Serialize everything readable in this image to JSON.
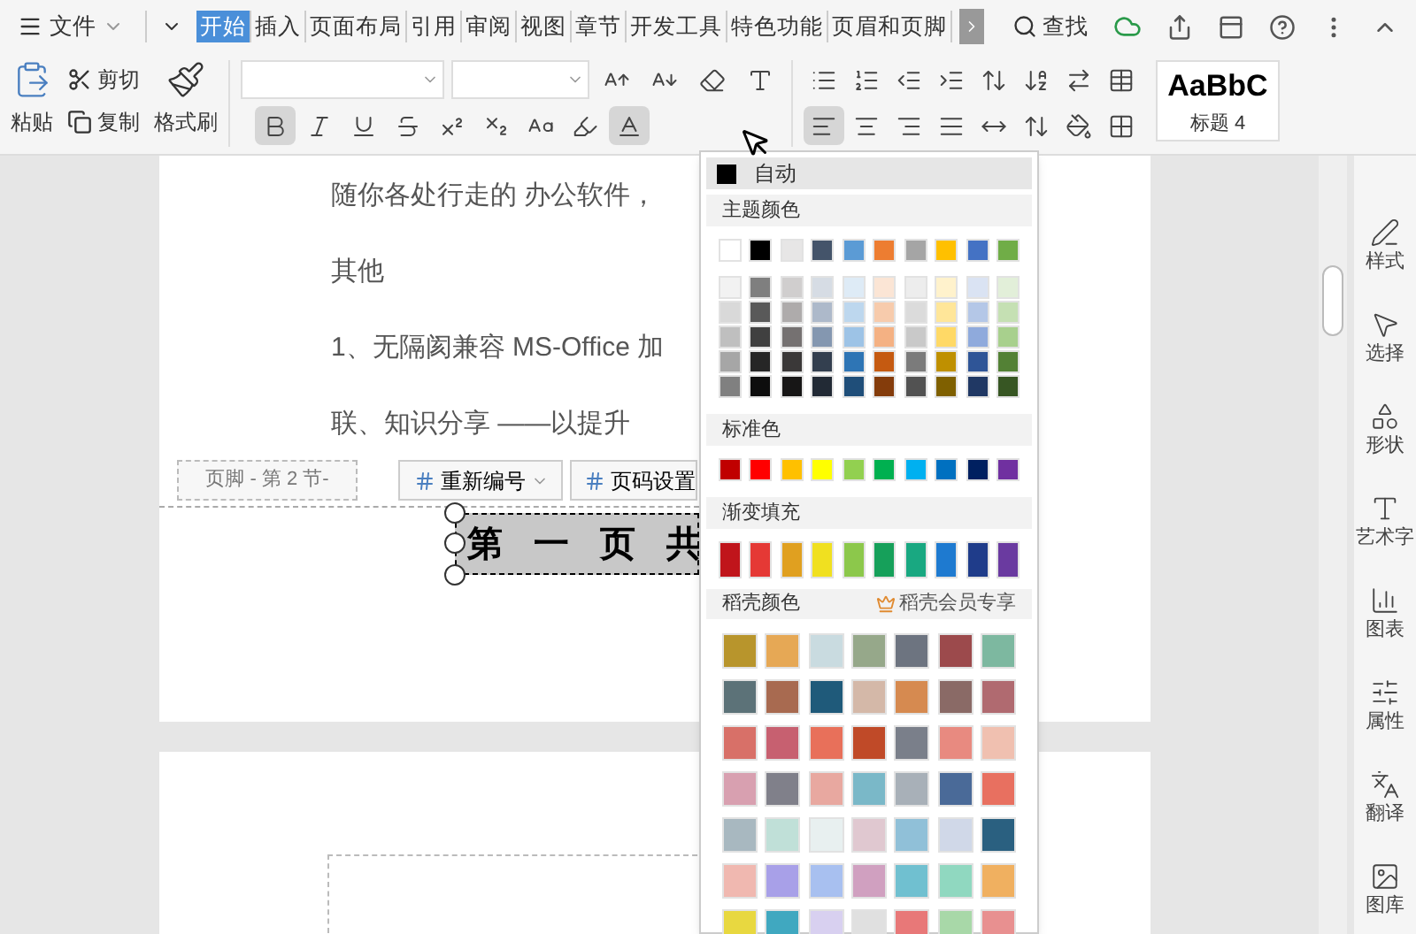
{
  "menu": {
    "label": "文件"
  },
  "tabs": [
    {
      "label": "开始",
      "selected": true
    },
    {
      "label": "插入",
      "selected": false
    },
    {
      "label": "页面布局",
      "selected": false
    },
    {
      "label": "引用",
      "selected": false
    },
    {
      "label": "审阅",
      "selected": false
    },
    {
      "label": "视图",
      "selected": false
    },
    {
      "label": "章节",
      "selected": false
    },
    {
      "label": "开发工具",
      "selected": false
    },
    {
      "label": "特色功能",
      "selected": false
    },
    {
      "label": "页眉和页脚",
      "selected": false
    }
  ],
  "search": {
    "label": "查找"
  },
  "ribbon": {
    "paste": "粘贴",
    "cut": "剪切",
    "copy": "复制",
    "format_painter": "格式刷",
    "font_tools": [
      {
        "kind": "grow",
        "pressed": false
      },
      {
        "kind": "shrink",
        "pressed": false
      },
      {
        "kind": "clear",
        "pressed": false
      },
      {
        "kind": "phonetic",
        "pressed": false
      }
    ],
    "format_buttons": [
      {
        "kind": "bold",
        "pressed": true
      },
      {
        "kind": "italic",
        "pressed": false
      },
      {
        "kind": "underline",
        "pressed": false
      },
      {
        "kind": "strike",
        "pressed": false
      },
      {
        "kind": "superscript",
        "pressed": false
      },
      {
        "kind": "subscript",
        "pressed": false
      },
      {
        "kind": "effect",
        "pressed": false
      },
      {
        "kind": "highlight",
        "pressed": false
      },
      {
        "kind": "color",
        "pressed": true
      }
    ],
    "paragraph_tools": [
      {
        "kind": "bullets",
        "pressed": false
      },
      {
        "kind": "numbering",
        "pressed": false
      },
      {
        "kind": "outdent",
        "pressed": false
      },
      {
        "kind": "indent",
        "pressed": false
      },
      {
        "kind": "spacing",
        "pressed": false
      },
      {
        "kind": "sort",
        "pressed": false
      },
      {
        "kind": "tabs",
        "pressed": false
      },
      {
        "kind": "table",
        "pressed": false
      }
    ],
    "align_tools": [
      {
        "kind": "left",
        "pressed": true
      },
      {
        "kind": "center",
        "pressed": false
      },
      {
        "kind": "right",
        "pressed": false
      },
      {
        "kind": "justify",
        "pressed": false
      },
      {
        "kind": "distribute",
        "pressed": false
      },
      {
        "kind": "linespacing",
        "pressed": false
      },
      {
        "kind": "shading",
        "pressed": false
      },
      {
        "kind": "borders",
        "pressed": false
      }
    ],
    "style": {
      "sample": "AaBbC",
      "name": "标题 4"
    }
  },
  "document": {
    "paragraphs": [
      "随你各处行走的 办公软件，",
      "其他",
      "1、无隔阂兼容 MS-Office 加",
      "联、知识分享 ——以提升"
    ],
    "footer": {
      "label": "页脚 - 第 2 节-",
      "buttons": [
        "重新编号",
        "页码设置"
      ],
      "text": "第 一 页 共"
    }
  },
  "color_menu": {
    "auto": {
      "label": "自动",
      "selected": true
    },
    "theme": {
      "title": "主题颜色",
      "colors": [
        {
          "color": "#ffffff"
        },
        {
          "color": "#000000"
        },
        {
          "color": "#e7e6e6"
        },
        {
          "color": "#44546a"
        },
        {
          "color": "#5b9bd5"
        },
        {
          "color": "#ed7d31"
        },
        {
          "color": "#a5a5a5"
        },
        {
          "color": "#ffc000"
        },
        {
          "color": "#4472c4"
        },
        {
          "color": "#70ad47"
        }
      ],
      "shades": [
        [
          {
            "color": "#f2f2f2"
          },
          {
            "color": "#7f7f7f"
          },
          {
            "color": "#d0cece"
          },
          {
            "color": "#d6dce4"
          },
          {
            "color": "#deebf6"
          },
          {
            "color": "#fbe5d5"
          },
          {
            "color": "#ededed"
          },
          {
            "color": "#fff2cc"
          },
          {
            "color": "#dae3f3"
          },
          {
            "color": "#e2efd9"
          }
        ],
        [
          {
            "color": "#d9d9d9"
          },
          {
            "color": "#595959"
          },
          {
            "color": "#aeabab"
          },
          {
            "color": "#adb9ca"
          },
          {
            "color": "#bdd7ee"
          },
          {
            "color": "#f7cbac"
          },
          {
            "color": "#dbdbdb"
          },
          {
            "color": "#ffe699"
          },
          {
            "color": "#b4c7e7"
          },
          {
            "color": "#c5e0b3"
          }
        ],
        [
          {
            "color": "#bfbfbf"
          },
          {
            "color": "#404040"
          },
          {
            "color": "#757171"
          },
          {
            "color": "#8497b0"
          },
          {
            "color": "#9dc3e6"
          },
          {
            "color": "#f4b183"
          },
          {
            "color": "#c9c9c9"
          },
          {
            "color": "#ffd966"
          },
          {
            "color": "#8faadc"
          },
          {
            "color": "#a8d08d"
          }
        ],
        [
          {
            "color": "#a6a6a6"
          },
          {
            "color": "#262626"
          },
          {
            "color": "#3a3838"
          },
          {
            "color": "#333f4f"
          },
          {
            "color": "#2e75b5"
          },
          {
            "color": "#c55a11"
          },
          {
            "color": "#7b7b7b"
          },
          {
            "color": "#bf9000"
          },
          {
            "color": "#2f5597"
          },
          {
            "color": "#538135"
          }
        ],
        [
          {
            "color": "#808080"
          },
          {
            "color": "#0d0d0d"
          },
          {
            "color": "#171616"
          },
          {
            "color": "#222a35"
          },
          {
            "color": "#1f4e79"
          },
          {
            "color": "#843c0b"
          },
          {
            "color": "#525252"
          },
          {
            "color": "#7f6000"
          },
          {
            "color": "#203864"
          },
          {
            "color": "#375623"
          }
        ]
      ]
    },
    "standard": {
      "title": "标准色",
      "colors": [
        {
          "color": "#c00000"
        },
        {
          "color": "#ff0000"
        },
        {
          "color": "#ffc000"
        },
        {
          "color": "#ffff00"
        },
        {
          "color": "#92d050"
        },
        {
          "color": "#00b050"
        },
        {
          "color": "#00b0f0"
        },
        {
          "color": "#0070c0"
        },
        {
          "color": "#002060"
        },
        {
          "color": "#7030a0"
        }
      ]
    },
    "gradient": {
      "title": "渐变填充",
      "colors": [
        {
          "color": "#c0151b"
        },
        {
          "color": "#e53935"
        },
        {
          "color": "#e0a020"
        },
        {
          "color": "#f0e020"
        },
        {
          "color": "#8cc84b"
        },
        {
          "color": "#16a05a"
        },
        {
          "color": "#19a881"
        },
        {
          "color": "#1e7ad0"
        },
        {
          "color": "#1f3c8a"
        },
        {
          "color": "#6a3aa0"
        }
      ]
    },
    "docer": {
      "title": "稻壳颜色",
      "badge": "稻壳会员专享",
      "rows": [
        [
          {
            "color": "#b8952c"
          },
          {
            "color": "#e6a855"
          },
          {
            "color": "#c9dbe0"
          },
          {
            "color": "#96a88a"
          },
          {
            "color": "#6d7480"
          },
          {
            "color": "#9c4a4c"
          },
          {
            "color": "#7db8a0"
          }
        ],
        [
          {
            "color": "#5c7278"
          },
          {
            "color": "#a86a50"
          },
          {
            "color": "#1f5a7a"
          },
          {
            "color": "#d4b8a8"
          },
          {
            "color": "#d68a50"
          },
          {
            "color": "#8a6a66"
          },
          {
            "color": "#b06a70"
          }
        ],
        [
          {
            "color": "#d87068"
          },
          {
            "color": "#c76070"
          },
          {
            "color": "#e8705a"
          },
          {
            "color": "#c04a28"
          },
          {
            "color": "#7a7f8a"
          },
          {
            "color": "#e88a80"
          },
          {
            "color": "#f0c0b0"
          }
        ],
        [
          {
            "color": "#d8a0b0"
          },
          {
            "color": "#80808a"
          },
          {
            "color": "#e8a8a0"
          },
          {
            "color": "#7ab8c8"
          },
          {
            "color": "#a8b0b8"
          },
          {
            "color": "#4a6a98"
          },
          {
            "color": "#e87060"
          }
        ],
        [
          {
            "color": "#a8b8c0"
          },
          {
            "color": "#c0e0d8"
          },
          {
            "color": "#e8f0f0"
          },
          {
            "color": "#e0c8d0"
          },
          {
            "color": "#90c0d8"
          },
          {
            "color": "#d0d8e8"
          },
          {
            "color": "#2a6080"
          }
        ],
        [
          {
            "color": "#f0b8b0"
          },
          {
            "color": "#a8a0e8"
          },
          {
            "color": "#a8c0f0"
          },
          {
            "color": "#d0a0c0"
          },
          {
            "color": "#70c0d0"
          },
          {
            "color": "#90d8c0"
          },
          {
            "color": "#f0b060"
          }
        ],
        [
          {
            "color": "#e8d840"
          },
          {
            "color": "#40a8c0"
          },
          {
            "color": "#d8d0f0"
          },
          {
            "color": "#e0e0e0"
          },
          {
            "color": "#e87878"
          },
          {
            "color": "#a8d8a8"
          },
          {
            "color": "#e89090"
          }
        ]
      ]
    }
  },
  "sidebar": [
    {
      "label": "样式"
    },
    {
      "label": "选择"
    },
    {
      "label": "形状"
    },
    {
      "label": "艺术字"
    },
    {
      "label": "图表"
    },
    {
      "label": "属性"
    },
    {
      "label": "翻译"
    },
    {
      "label": "图库"
    }
  ]
}
